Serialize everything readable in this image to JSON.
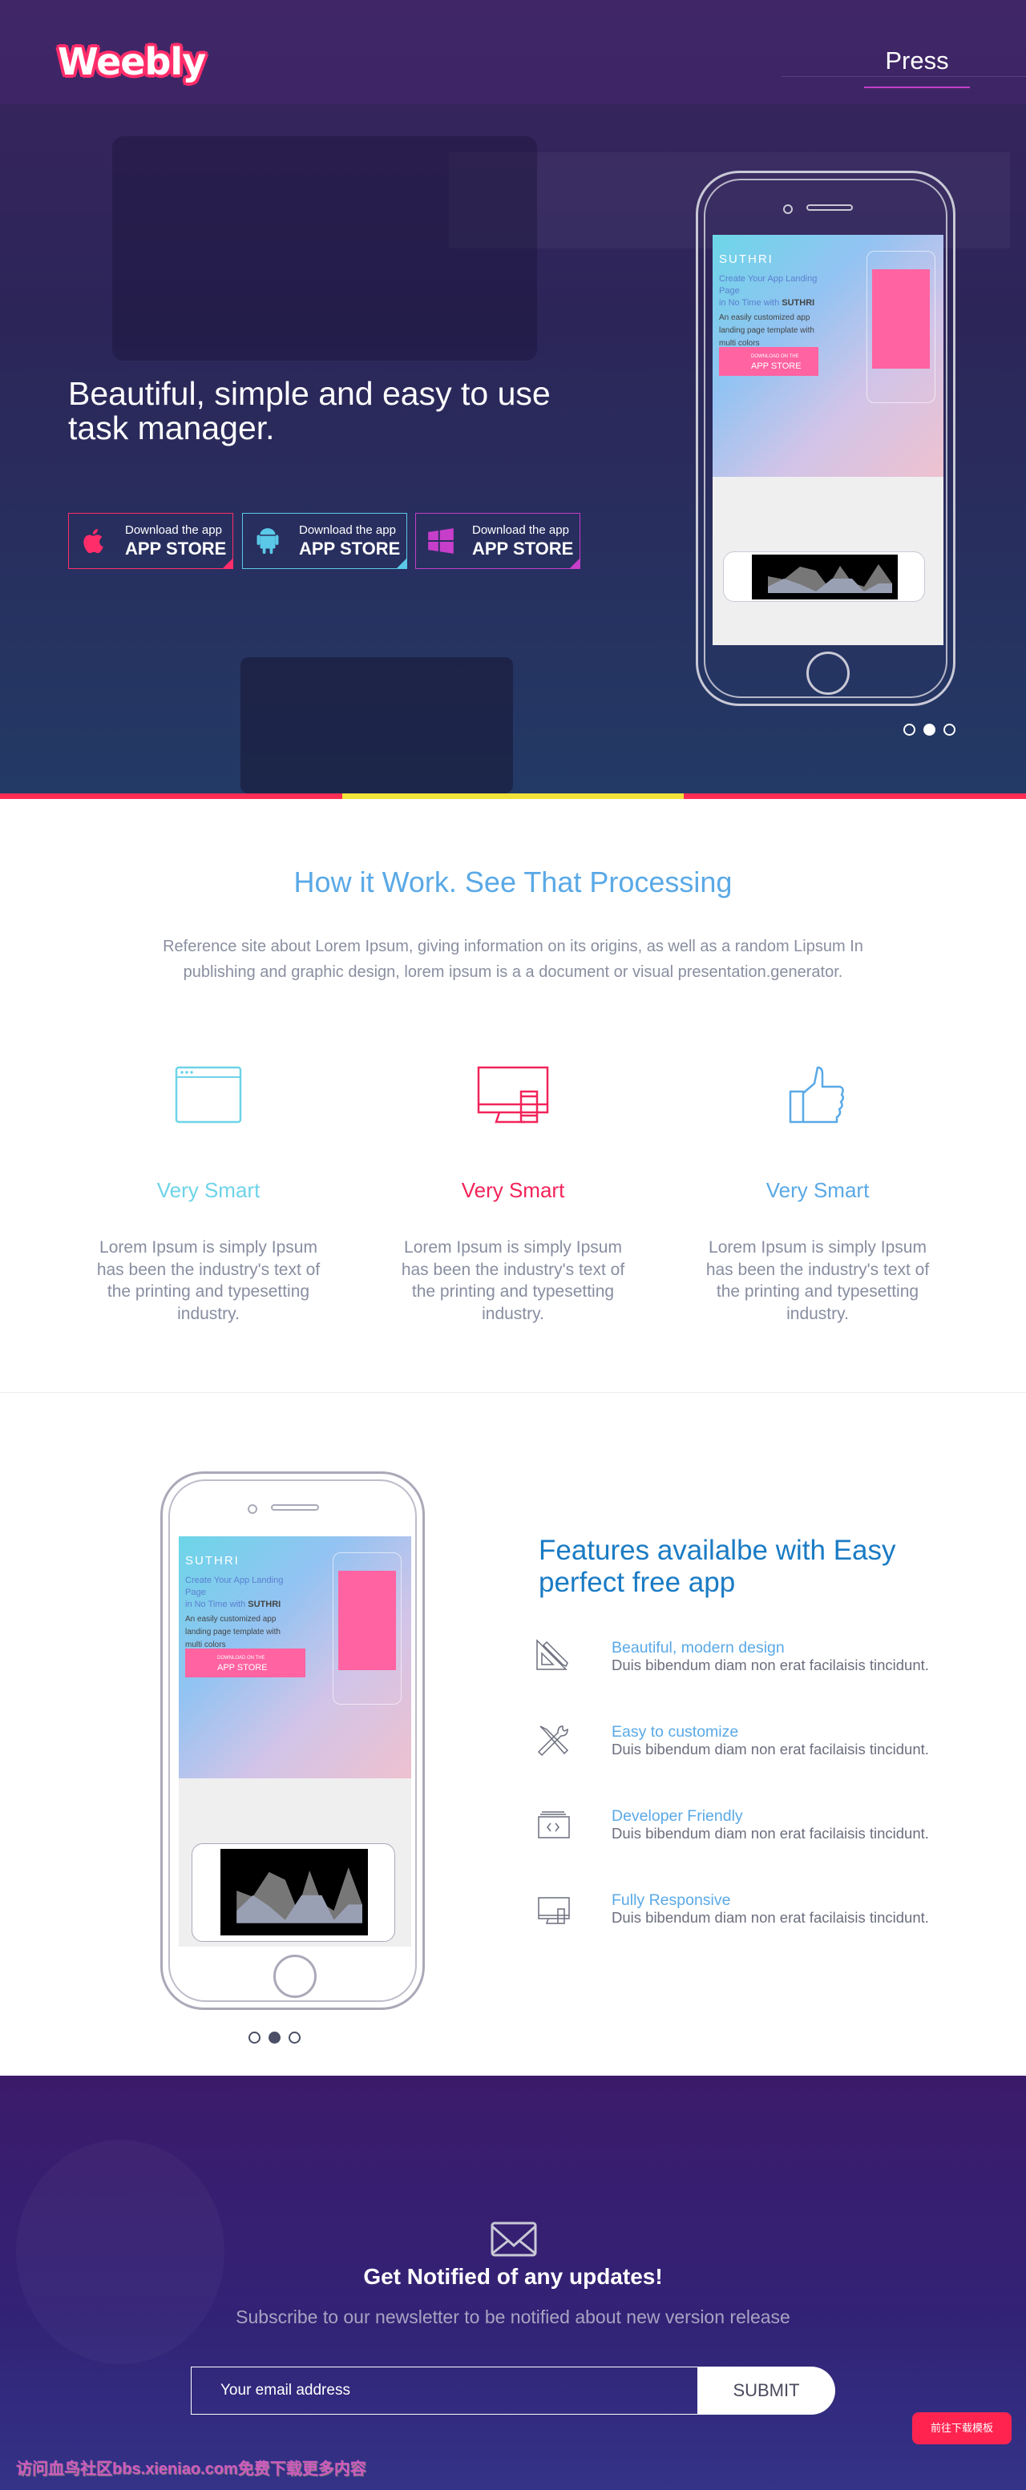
{
  "header": {
    "logo": "Weebly",
    "nav": [
      {
        "label": "Press",
        "active": true
      }
    ]
  },
  "hero": {
    "headline": "Beautiful, simple and easy to use task manager.",
    "buttons": [
      {
        "line1": "Download the app",
        "line2": "APP STORE",
        "icon": "apple-icon",
        "color": "#ff2d6a"
      },
      {
        "line1": "Download the app",
        "line2": "APP STORE",
        "icon": "android-icon",
        "color": "#5bc8e8"
      },
      {
        "line1": "Download the app",
        "line2": "APP STORE",
        "icon": "windows-icon",
        "color": "#c63ec9"
      }
    ],
    "mockup": {
      "brand": "SUTHRI",
      "line1": "Create Your App Landing Page",
      "line2": "in No Time with",
      "line2_bold": "SUTHRI",
      "desc": "An easily customized app landing page template with multi colors",
      "btn_small": "DOWNLOAD ON THE",
      "btn_big": "APP STORE"
    },
    "carousel": {
      "count": 3,
      "active": 1
    },
    "bar_colors": [
      "#ff2d55",
      "#f2e33a",
      "#ff2d55"
    ]
  },
  "how": {
    "title": "How it Work. See That Processing",
    "intro": "Reference site about Lorem Ipsum, giving information on its origins, as well as a random Lipsum In publishing and graphic design, lorem ipsum is a a document or visual presentation.generator.",
    "columns": [
      {
        "icon": "browser-window-icon",
        "title": "Very Smart",
        "color": "#6ed3e8",
        "text": "Lorem Ipsum is simply Ipsum has been the industry's text of the printing and typesetting industry."
      },
      {
        "icon": "devices-icon",
        "title": "Very Smart",
        "color": "#f2245a",
        "text": "Lorem Ipsum is simply Ipsum has been the industry's text of the printing and typesetting industry."
      },
      {
        "icon": "thumbs-up-icon",
        "title": "Very Smart",
        "color": "#5aa9e6",
        "text": "Lorem Ipsum is simply Ipsum has been the industry's text of the printing and typesetting industry."
      }
    ]
  },
  "features": {
    "title": "Features availalbe with Easy perfect free app",
    "items": [
      {
        "icon": "ruler-pencil-icon",
        "title": "Beautiful, modern design",
        "desc": "Duis bibendum diam non erat facilaisis tincidunt."
      },
      {
        "icon": "tools-icon",
        "title": "Easy to customize",
        "desc": "Duis bibendum diam non erat facilaisis tincidunt."
      },
      {
        "icon": "code-window-icon",
        "title": "Developer Friendly",
        "desc": "Duis bibendum diam non erat facilaisis tincidunt."
      },
      {
        "icon": "responsive-devices-icon",
        "title": "Fully Responsive",
        "desc": "Duis bibendum diam non erat facilaisis tincidunt."
      }
    ],
    "carousel": {
      "count": 3,
      "active": 1
    }
  },
  "newsletter": {
    "title": "Get Notified of any updates!",
    "subtitle": "Subscribe to our newsletter to be notified about new version release",
    "email_placeholder": "Your email address",
    "submit": "SUBMIT"
  },
  "download_badge": "前往下载模板",
  "watermark": "访问血鸟社区bbs.xieniao.com免费下载更多内容"
}
